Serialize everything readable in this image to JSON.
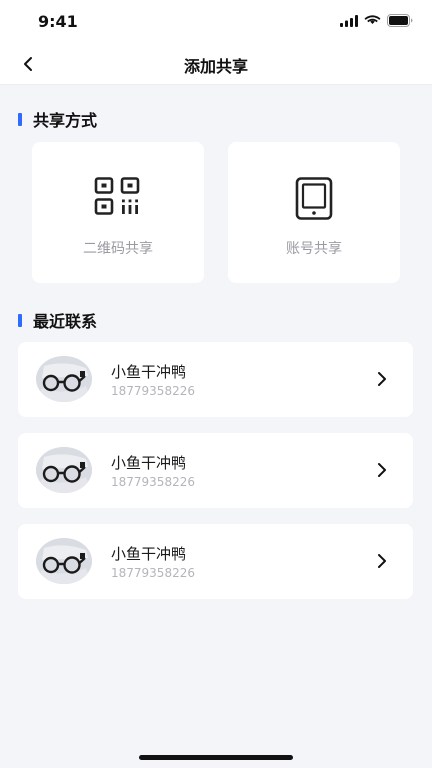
{
  "status": {
    "time": "9:41"
  },
  "nav": {
    "title": "添加共享"
  },
  "share_section": {
    "title": "共享方式",
    "options": [
      {
        "label": "二维码共享",
        "icon": "qr-code-icon"
      },
      {
        "label": "账号共享",
        "icon": "tablet-icon"
      }
    ]
  },
  "contacts_section": {
    "title": "最近联系",
    "contacts": [
      {
        "name": "小鱼干冲鸭",
        "phone": "18779358226"
      },
      {
        "name": "小鱼干冲鸭",
        "phone": "18779358226"
      },
      {
        "name": "小鱼干冲鸭",
        "phone": "18779358226"
      }
    ]
  },
  "colors": {
    "accent": "#2f6bff",
    "background": "#f4f5f9"
  }
}
